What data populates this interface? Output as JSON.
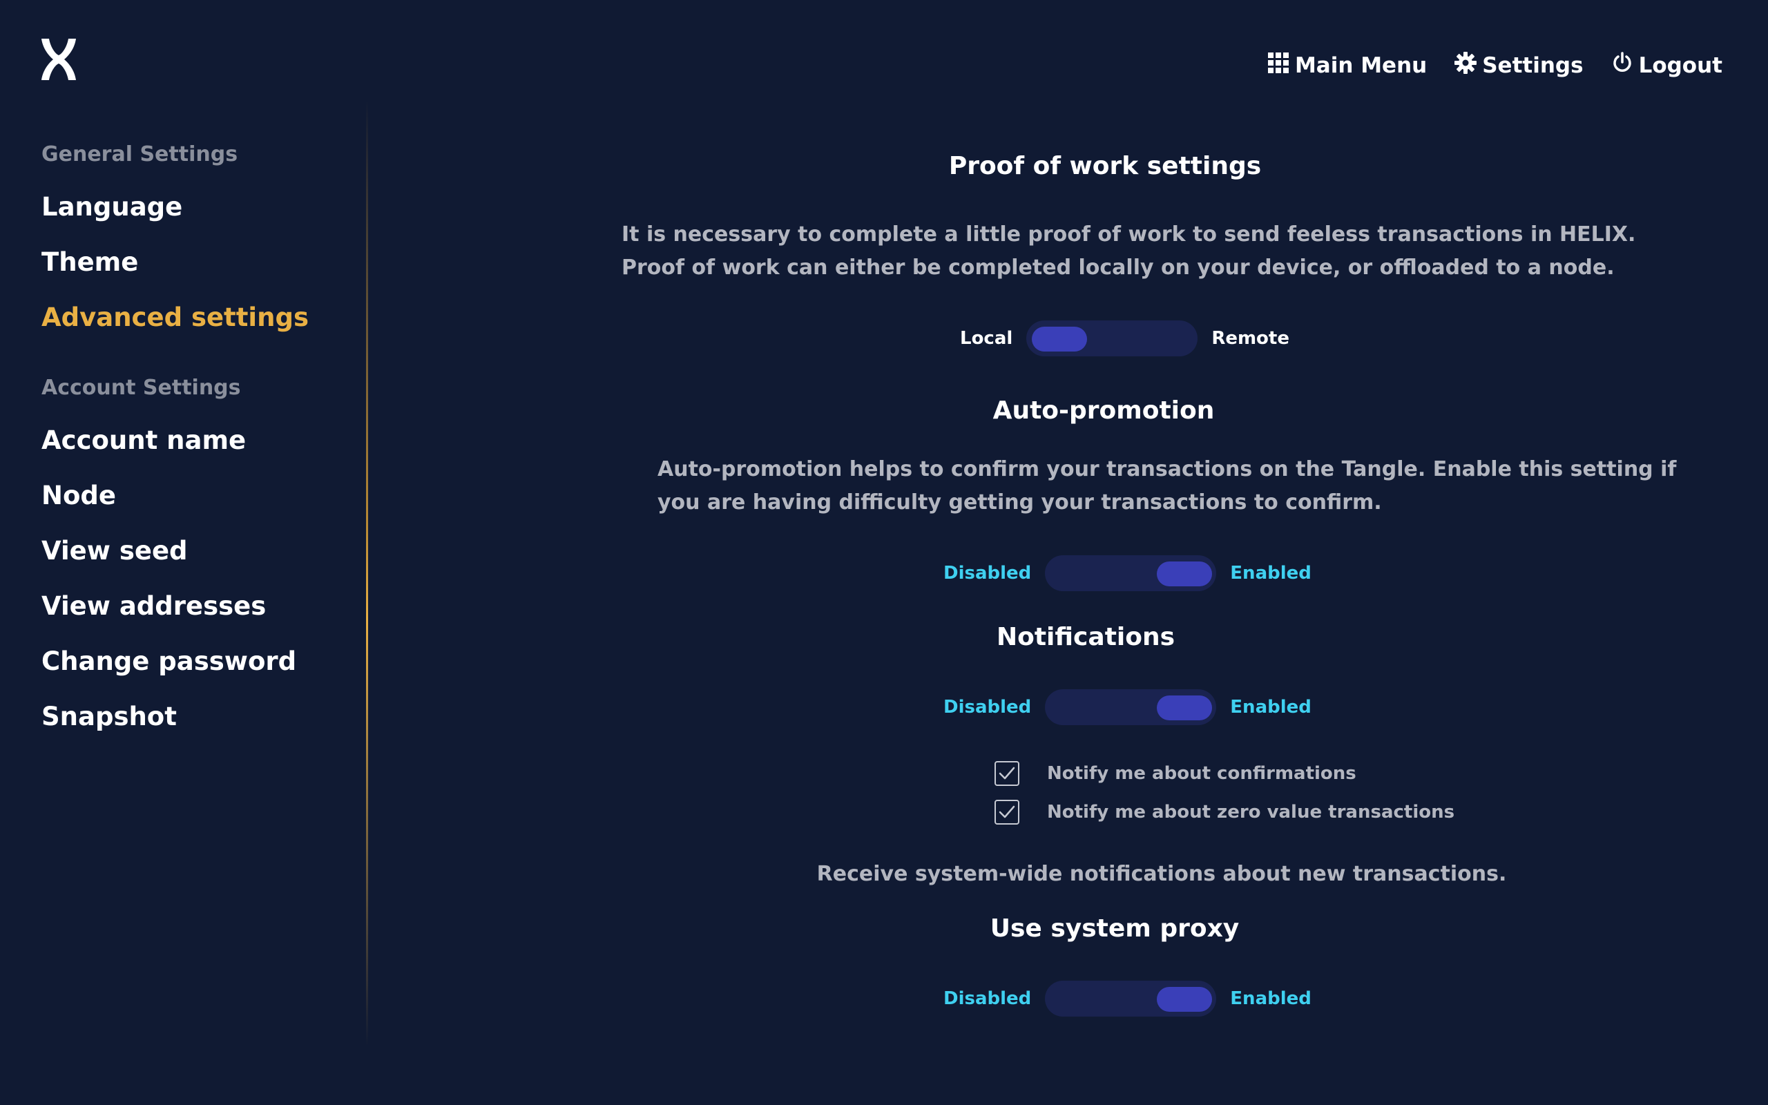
{
  "colors": {
    "background": "#101a33",
    "accent": "#e9b044",
    "toggle_track": "#1a2350",
    "toggle_knob": "#3a3fb8",
    "label_cyan": "#3fd0f0",
    "muted_text": "#b3b6c0"
  },
  "logo": {
    "icon": "helix-logo-icon"
  },
  "topnav": {
    "main_menu": {
      "label": "Main Menu",
      "icon": "grid-icon"
    },
    "settings": {
      "label": "Settings",
      "icon": "gear-icon"
    },
    "logout": {
      "label": "Logout",
      "icon": "power-icon"
    }
  },
  "sidebar": {
    "general_label": "General Settings",
    "general_items": [
      {
        "label": "Language",
        "active": false
      },
      {
        "label": "Theme",
        "active": false
      },
      {
        "label": "Advanced settings",
        "active": true
      }
    ],
    "account_label": "Account Settings",
    "account_items": [
      {
        "label": "Account name"
      },
      {
        "label": "Node"
      },
      {
        "label": "View seed"
      },
      {
        "label": "View addresses"
      },
      {
        "label": "Change password"
      },
      {
        "label": "Snapshot"
      }
    ]
  },
  "pow": {
    "title": "Proof of work settings",
    "description": "It is necessary to complete a little proof of work to send feeless transactions in HELIX. Proof of work can either be completed locally on your device, or offloaded to a node.",
    "left_label": "Local",
    "right_label": "Remote",
    "selected": "Local"
  },
  "autopromotion": {
    "title": "Auto-promotion",
    "description": "Auto-promotion helps to confirm your transactions on the Tangle. Enable this setting if you are having difficulty getting your transactions to confirm.",
    "left_label": "Disabled",
    "right_label": "Enabled",
    "selected": "Enabled"
  },
  "notifications": {
    "title": "Notifications",
    "left_label": "Disabled",
    "right_label": "Enabled",
    "selected": "Enabled",
    "options": [
      {
        "label": "Notify me about confirmations",
        "checked": true
      },
      {
        "label": "Notify me about zero value transactions",
        "checked": true
      }
    ],
    "note": "Receive system-wide notifications about new transactions."
  },
  "proxy": {
    "title": "Use system proxy",
    "left_label": "Disabled",
    "right_label": "Enabled",
    "selected": "Enabled"
  }
}
